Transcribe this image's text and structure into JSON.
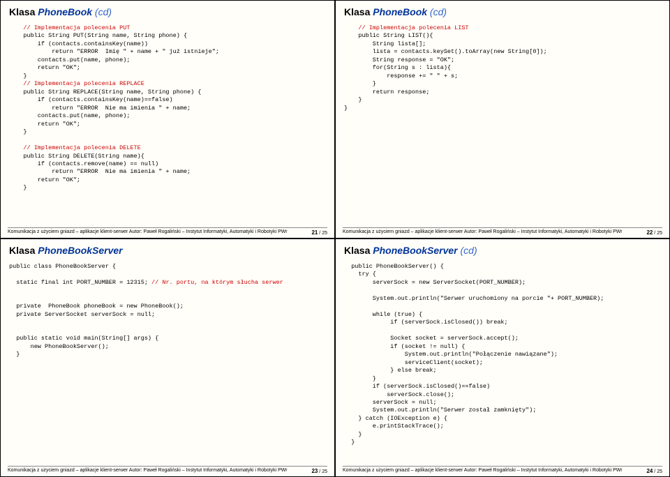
{
  "slides": {
    "s21": {
      "title_prefix": "Klasa",
      "title_class": "PhoneBook",
      "title_suffix": "(cd)",
      "c1": "    // Implementacja polecenia PUT",
      "l1": "    public String PUT(String name, String phone) {",
      "l2": "        if (contacts.containsKey(name))",
      "l3": "            return \"ERROR  Imię \" + name + \" już istnieje\";",
      "l4": "        contacts.put(name, phone);",
      "l5": "        return \"OK\";",
      "l6": "    }",
      "c2": "    // Implementacja polecenia REPLACE",
      "l7": "    public String REPLACE(String name, String phone) {",
      "l8": "        if (contacts.containsKey(name)==false)",
      "l9": "            return \"ERROR  Nie ma imienia \" + name;",
      "l10": "        contacts.put(name, phone);",
      "l11": "        return \"OK\";",
      "l12": "    }",
      "c3": "    // Implementacja polecenia DELETE",
      "l13": "    public String DELETE(String name){",
      "l14": "        if (contacts.remove(name) == null)",
      "l15": "            return \"ERROR  Nie ma imienia \" + name;",
      "l16": "        return \"OK\";",
      "l17": "    }",
      "footer_text": "Komunikacja z użyciem gniazd – aplikacje klient-serwer  Autor: Paweł Rogaliński – Instytut Informatyki, Automatyki i Robotyki PWr",
      "page": "21",
      "total": "25"
    },
    "s22": {
      "title_prefix": "Klasa",
      "title_class": "PhoneBook",
      "title_suffix": "(cd)",
      "c1": "    // Implementacja polecenia LIST",
      "l1": "    public String LIST(){",
      "l2": "        String lista[];",
      "l3": "        lista = contacts.keySet().toArray(new String[0]);",
      "l4": "        String response = \"OK\";",
      "l5": "        for(String s : lista){",
      "l6": "            response += \" \" + s;",
      "l7": "        }",
      "l8": "        return response;",
      "l9": "    }",
      "l10": "}",
      "footer_text": "Komunikacja z użyciem gniazd – aplikacje klient-serwer  Autor: Paweł Rogaliński – Instytut Informatyki, Automatyki i Robotyki PWr",
      "page": "22",
      "total": "25"
    },
    "s23": {
      "title_prefix": "Klasa",
      "title_class": "PhoneBookServer",
      "title_suffix": "",
      "l1": "public class PhoneBookServer {",
      "l2": "  static final int PORT_NUMBER = 12315;",
      "c1": " // Nr. portu, na którym słucha serwer",
      "l3": "  private  PhoneBook phoneBook = new PhoneBook();",
      "l4": "  private ServerSocket serverSock = null;",
      "l5": "  public static void main(String[] args) {",
      "l6": "      new PhoneBookServer();",
      "l7": "  }",
      "footer_text": "Komunikacja z użyciem gniazd – aplikacje klient-serwer  Autor: Paweł Rogaliński – Instytut Informatyki, Automatyki i Robotyki PWr",
      "page": "23",
      "total": "25"
    },
    "s24": {
      "title_prefix": "Klasa",
      "title_class": "PhoneBookServer",
      "title_suffix": "(cd)",
      "l1": "  public PhoneBookServer() {",
      "l2": "    try {",
      "l3": "        serverSock = new ServerSocket(PORT_NUMBER);",
      "l4": "        System.out.println(\"Serwer uruchomiony na porcie \"+ PORT_NUMBER);",
      "l5": "        while (true) {",
      "l6": "             if (serverSock.isClosed()) break;",
      "l7": "             Socket socket = serverSock.accept();",
      "l8": "             if (socket != null) {",
      "l9": "                 System.out.println(\"Połączenie nawiązane\");",
      "l10": "                 serviceClient(socket);",
      "l11": "             } else break;",
      "l12": "        }",
      "l13": "        if (serverSock.isClosed()==false)",
      "l14": "            serverSock.close();",
      "l15": "        serverSock = null;",
      "l16": "        System.out.println(\"Serwer został zamknięty\");",
      "l17": "    } catch (IOException e) {",
      "l18": "        e.printStackTrace();",
      "l19": "    }",
      "l20": "  }",
      "footer_text": "Komunikacja z użyciem gniazd – aplikacje klient-serwer  Autor: Paweł Rogaliński – Instytut Informatyki, Automatyki i Robotyki PWr",
      "page": "24",
      "total": "25"
    }
  }
}
